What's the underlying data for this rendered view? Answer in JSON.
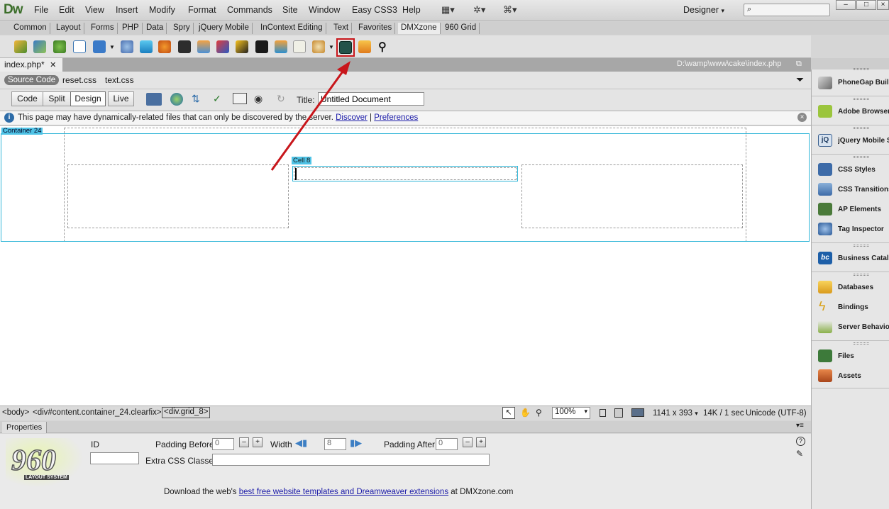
{
  "app": {
    "logo": "Dw"
  },
  "menu": [
    "File",
    "Edit",
    "View",
    "Insert",
    "Modify",
    "Format",
    "Commands",
    "Site",
    "Window",
    "Easy CSS3",
    "Help"
  ],
  "workspace": {
    "label": "Designer"
  },
  "insert_tabs": [
    "Common",
    "Layout",
    "Forms",
    "PHP",
    "Data",
    "Spry",
    "jQuery Mobile",
    "InContext Editing",
    "Text",
    "Favorites",
    "DMXzone",
    "960 Grid"
  ],
  "active_insert_tab": "DMXzone",
  "document": {
    "tab_label": "index.php*",
    "path": "D:\\wamp\\www\\cake\\index.php",
    "related_files": [
      "Source Code",
      "reset.css",
      "text.css"
    ]
  },
  "view_buttons": [
    "Code",
    "Split",
    "Design",
    "Live"
  ],
  "active_view": "Design",
  "title": {
    "label": "Title:",
    "value": "Untitled Document"
  },
  "infobar": {
    "message": "This page may have dynamically-related files that can only be discovered by the server.",
    "discover": "Discover",
    "separator": "|",
    "preferences": "Preferences"
  },
  "design": {
    "container_label": "Container 24",
    "cell_label": "Cell 8"
  },
  "status": {
    "tags": [
      "<body>",
      "<div#content.container_24.clearfix>"
    ],
    "current_tag": "<div.grid_8>",
    "zoom": "100%",
    "dimensions": "1141 x 393",
    "size_time": "14K / 1 sec",
    "encoding": "Unicode (UTF-8)"
  },
  "properties": {
    "tab": "Properties",
    "logo_text": "960",
    "logo_sub": "LAYOUT SYSTEM",
    "id_label": "ID",
    "padding_before_label": "Padding Before",
    "padding_before_value": "0",
    "width_label": "Width",
    "width_value": "8",
    "padding_after_label": "Padding After",
    "padding_after_value": "0",
    "extra_css_label": "Extra CSS Classes",
    "download_prefix": "Download the web's ",
    "download_link": "best free website templates and Dreamweaver extensions",
    "download_suffix": " at DMXzone.com"
  },
  "panels": [
    "PhoneGap Build",
    "Adobe BrowserLab",
    "jQuery Mobile Swatches",
    "CSS Styles",
    "CSS Transitions",
    "AP Elements",
    "Tag Inspector",
    "Business Catalyst",
    "Databases",
    "Bindings",
    "Server Behaviors",
    "Files",
    "Assets"
  ],
  "colors": {
    "accent_cyan": "#31b6d8",
    "annotation_red": "#c8161b",
    "dw_green": "#3b6e2a"
  }
}
